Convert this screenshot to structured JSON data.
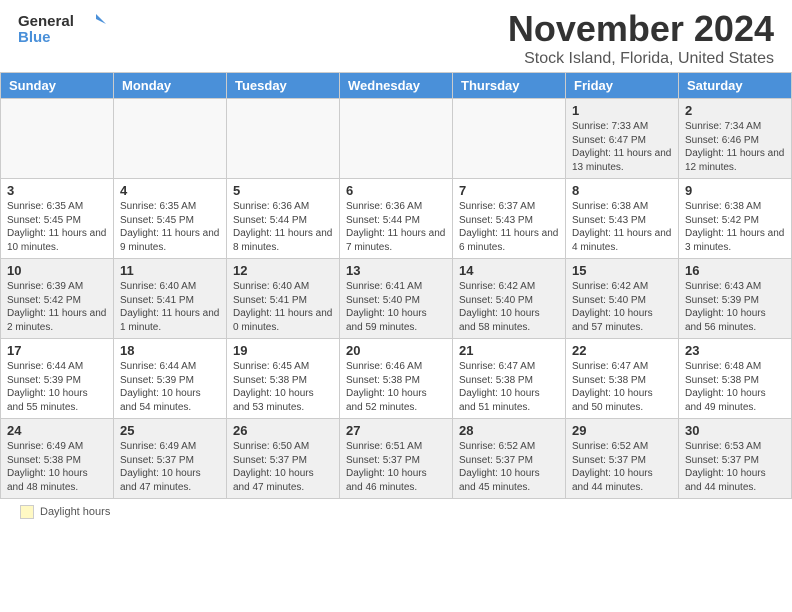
{
  "header": {
    "logo_general": "General",
    "logo_blue": "Blue",
    "main_title": "November 2024",
    "subtitle": "Stock Island, Florida, United States"
  },
  "calendar": {
    "days_of_week": [
      "Sunday",
      "Monday",
      "Tuesday",
      "Wednesday",
      "Thursday",
      "Friday",
      "Saturday"
    ],
    "weeks": [
      [
        {
          "day": "",
          "info": "",
          "empty": true
        },
        {
          "day": "",
          "info": "",
          "empty": true
        },
        {
          "day": "",
          "info": "",
          "empty": true
        },
        {
          "day": "",
          "info": "",
          "empty": true
        },
        {
          "day": "",
          "info": "",
          "empty": true
        },
        {
          "day": "1",
          "info": "Sunrise: 7:33 AM\nSunset: 6:47 PM\nDaylight: 11 hours and 13 minutes."
        },
        {
          "day": "2",
          "info": "Sunrise: 7:34 AM\nSunset: 6:46 PM\nDaylight: 11 hours and 12 minutes."
        }
      ],
      [
        {
          "day": "3",
          "info": "Sunrise: 6:35 AM\nSunset: 5:45 PM\nDaylight: 11 hours and 10 minutes."
        },
        {
          "day": "4",
          "info": "Sunrise: 6:35 AM\nSunset: 5:45 PM\nDaylight: 11 hours and 9 minutes."
        },
        {
          "day": "5",
          "info": "Sunrise: 6:36 AM\nSunset: 5:44 PM\nDaylight: 11 hours and 8 minutes."
        },
        {
          "day": "6",
          "info": "Sunrise: 6:36 AM\nSunset: 5:44 PM\nDaylight: 11 hours and 7 minutes."
        },
        {
          "day": "7",
          "info": "Sunrise: 6:37 AM\nSunset: 5:43 PM\nDaylight: 11 hours and 6 minutes."
        },
        {
          "day": "8",
          "info": "Sunrise: 6:38 AM\nSunset: 5:43 PM\nDaylight: 11 hours and 4 minutes."
        },
        {
          "day": "9",
          "info": "Sunrise: 6:38 AM\nSunset: 5:42 PM\nDaylight: 11 hours and 3 minutes."
        }
      ],
      [
        {
          "day": "10",
          "info": "Sunrise: 6:39 AM\nSunset: 5:42 PM\nDaylight: 11 hours and 2 minutes."
        },
        {
          "day": "11",
          "info": "Sunrise: 6:40 AM\nSunset: 5:41 PM\nDaylight: 11 hours and 1 minute."
        },
        {
          "day": "12",
          "info": "Sunrise: 6:40 AM\nSunset: 5:41 PM\nDaylight: 11 hours and 0 minutes."
        },
        {
          "day": "13",
          "info": "Sunrise: 6:41 AM\nSunset: 5:40 PM\nDaylight: 10 hours and 59 minutes."
        },
        {
          "day": "14",
          "info": "Sunrise: 6:42 AM\nSunset: 5:40 PM\nDaylight: 10 hours and 58 minutes."
        },
        {
          "day": "15",
          "info": "Sunrise: 6:42 AM\nSunset: 5:40 PM\nDaylight: 10 hours and 57 minutes."
        },
        {
          "day": "16",
          "info": "Sunrise: 6:43 AM\nSunset: 5:39 PM\nDaylight: 10 hours and 56 minutes."
        }
      ],
      [
        {
          "day": "17",
          "info": "Sunrise: 6:44 AM\nSunset: 5:39 PM\nDaylight: 10 hours and 55 minutes."
        },
        {
          "day": "18",
          "info": "Sunrise: 6:44 AM\nSunset: 5:39 PM\nDaylight: 10 hours and 54 minutes."
        },
        {
          "day": "19",
          "info": "Sunrise: 6:45 AM\nSunset: 5:38 PM\nDaylight: 10 hours and 53 minutes."
        },
        {
          "day": "20",
          "info": "Sunrise: 6:46 AM\nSunset: 5:38 PM\nDaylight: 10 hours and 52 minutes."
        },
        {
          "day": "21",
          "info": "Sunrise: 6:47 AM\nSunset: 5:38 PM\nDaylight: 10 hours and 51 minutes."
        },
        {
          "day": "22",
          "info": "Sunrise: 6:47 AM\nSunset: 5:38 PM\nDaylight: 10 hours and 50 minutes."
        },
        {
          "day": "23",
          "info": "Sunrise: 6:48 AM\nSunset: 5:38 PM\nDaylight: 10 hours and 49 minutes."
        }
      ],
      [
        {
          "day": "24",
          "info": "Sunrise: 6:49 AM\nSunset: 5:38 PM\nDaylight: 10 hours and 48 minutes."
        },
        {
          "day": "25",
          "info": "Sunrise: 6:49 AM\nSunset: 5:37 PM\nDaylight: 10 hours and 47 minutes."
        },
        {
          "day": "26",
          "info": "Sunrise: 6:50 AM\nSunset: 5:37 PM\nDaylight: 10 hours and 47 minutes."
        },
        {
          "day": "27",
          "info": "Sunrise: 6:51 AM\nSunset: 5:37 PM\nDaylight: 10 hours and 46 minutes."
        },
        {
          "day": "28",
          "info": "Sunrise: 6:52 AM\nSunset: 5:37 PM\nDaylight: 10 hours and 45 minutes."
        },
        {
          "day": "29",
          "info": "Sunrise: 6:52 AM\nSunset: 5:37 PM\nDaylight: 10 hours and 44 minutes."
        },
        {
          "day": "30",
          "info": "Sunrise: 6:53 AM\nSunset: 5:37 PM\nDaylight: 10 hours and 44 minutes."
        }
      ]
    ]
  },
  "footer": {
    "label": "Daylight hours"
  }
}
